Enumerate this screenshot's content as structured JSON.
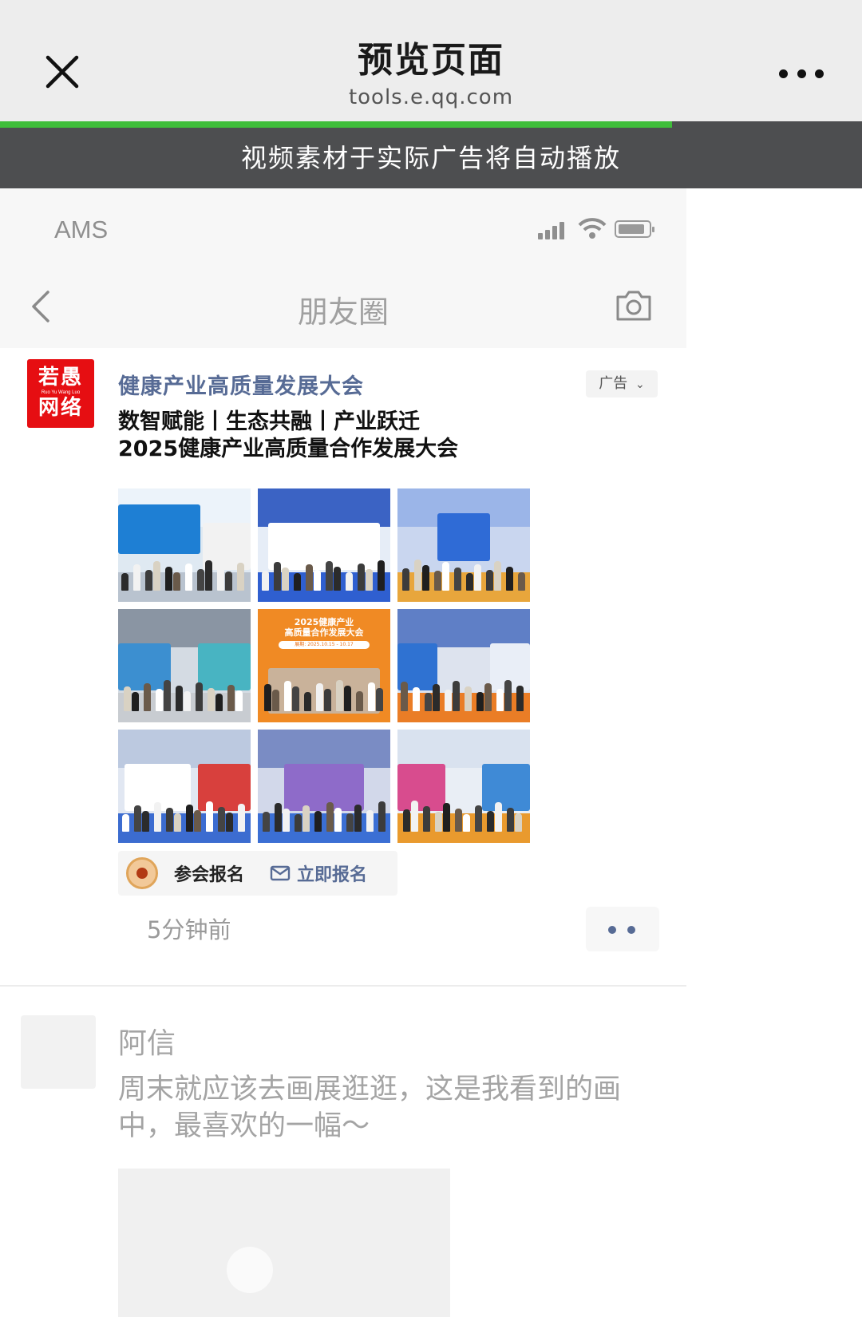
{
  "browser": {
    "title": "预览页面",
    "domain": "tools.e.qq.com",
    "load_progress": 0.78,
    "notice": "视频素材于实际广告将自动播放"
  },
  "status_bar": {
    "carrier": "AMS"
  },
  "moments_nav": {
    "title": "朋友圈"
  },
  "ad_post": {
    "advertiser": "健康产业高质量发展大会",
    "ad_label": "广告",
    "logo_text_top": "若愚",
    "logo_text_small": "Ruo Yu Wang Luo",
    "logo_text_bottom": "网络",
    "text_lines": [
      "数智赋能丨生态共融丨产业跃迁",
      "2025健康产业高质量合作发展大会"
    ],
    "poster_title": "2025健康产业\n高质量合作发展大会",
    "poster_date": "展期: 2025.10.15 - 10.17",
    "cta_label": "参会报名",
    "cta_link": "立即报名",
    "time": "5分钟前"
  },
  "post2": {
    "name": "阿信",
    "text_lines": [
      "周末就应该去画展逛逛，这是我看到的画",
      "中，最喜欢的一幅～"
    ]
  },
  "colors": {
    "progress": "#3fbd3a",
    "banner": "#4d4e50",
    "link_blue": "#576b95",
    "brand_red": "#e60e12"
  }
}
